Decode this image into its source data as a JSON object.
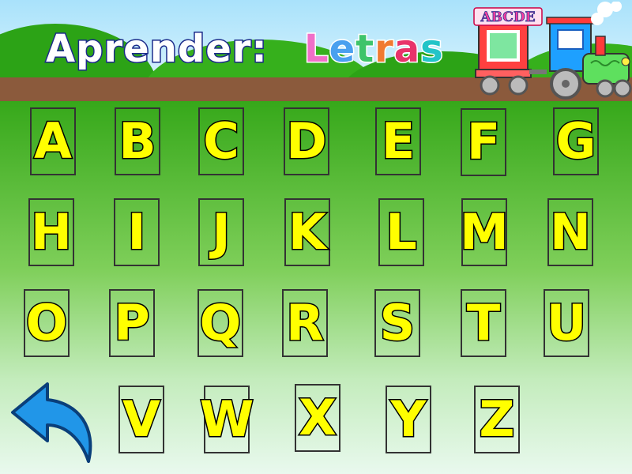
{
  "title": {
    "prefix": "Aprender:",
    "word_letters": [
      {
        "char": "L",
        "color": "#f06fc8"
      },
      {
        "char": "e",
        "color": "#4aa0ef"
      },
      {
        "char": "t",
        "color": "#3ec46a"
      },
      {
        "char": "r",
        "color": "#f07a30"
      },
      {
        "char": "a",
        "color": "#e8336b"
      },
      {
        "char": "s",
        "color": "#22c4c8"
      }
    ]
  },
  "letters": [
    "A",
    "B",
    "C",
    "D",
    "E",
    "F",
    "G",
    "H",
    "I",
    "J",
    "K",
    "L",
    "M",
    "N",
    "O",
    "P",
    "Q",
    "R",
    "S",
    "T",
    "U",
    "V",
    "W",
    "X",
    "Y",
    "Z"
  ],
  "train_sign": "ABCDE",
  "back_icon": "back-arrow-icon",
  "colors": {
    "letter_fill": "#ffff00",
    "letter_outline": "#000000",
    "grass": "#3fae1e",
    "sky": "#bfe9fb",
    "rail": "#8b5a3c",
    "arrow": "#2196e8"
  }
}
